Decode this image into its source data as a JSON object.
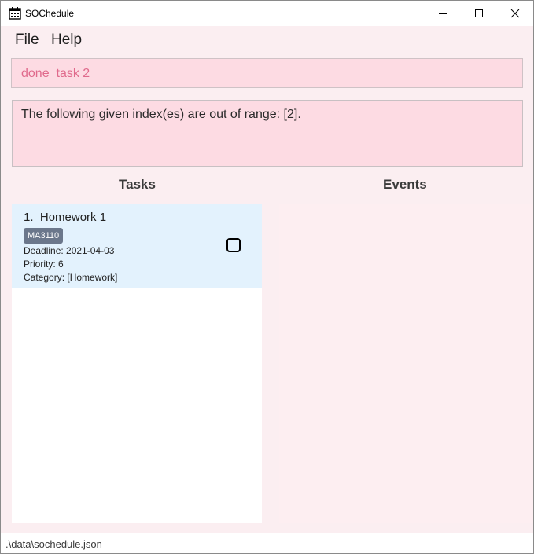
{
  "window": {
    "title": "SOChedule",
    "icon": "calendar-icon",
    "controls": [
      "minimize-icon",
      "maximize-icon",
      "close-icon"
    ]
  },
  "menu": {
    "file": "File",
    "help": "Help"
  },
  "command": {
    "value": "done_task 2"
  },
  "result": {
    "text": "The following given index(es) are out of range: [2]."
  },
  "panels": {
    "tasks_title": "Tasks",
    "events_title": "Events"
  },
  "tasks": [
    {
      "index": "1.",
      "name": "Homework 1",
      "tag": "MA3110",
      "deadline": "Deadline: 2021-04-03",
      "priority": "Priority: 6",
      "category": "Category: [Homework]",
      "checked": false
    }
  ],
  "status": {
    "path": ".\\data\\sochedule.json"
  },
  "colors": {
    "background": "#fbeef1",
    "command_box": "#fddbe3",
    "command_text": "#e06a8c",
    "task_card": "#e3f2fd",
    "tag": "#6b778b"
  }
}
